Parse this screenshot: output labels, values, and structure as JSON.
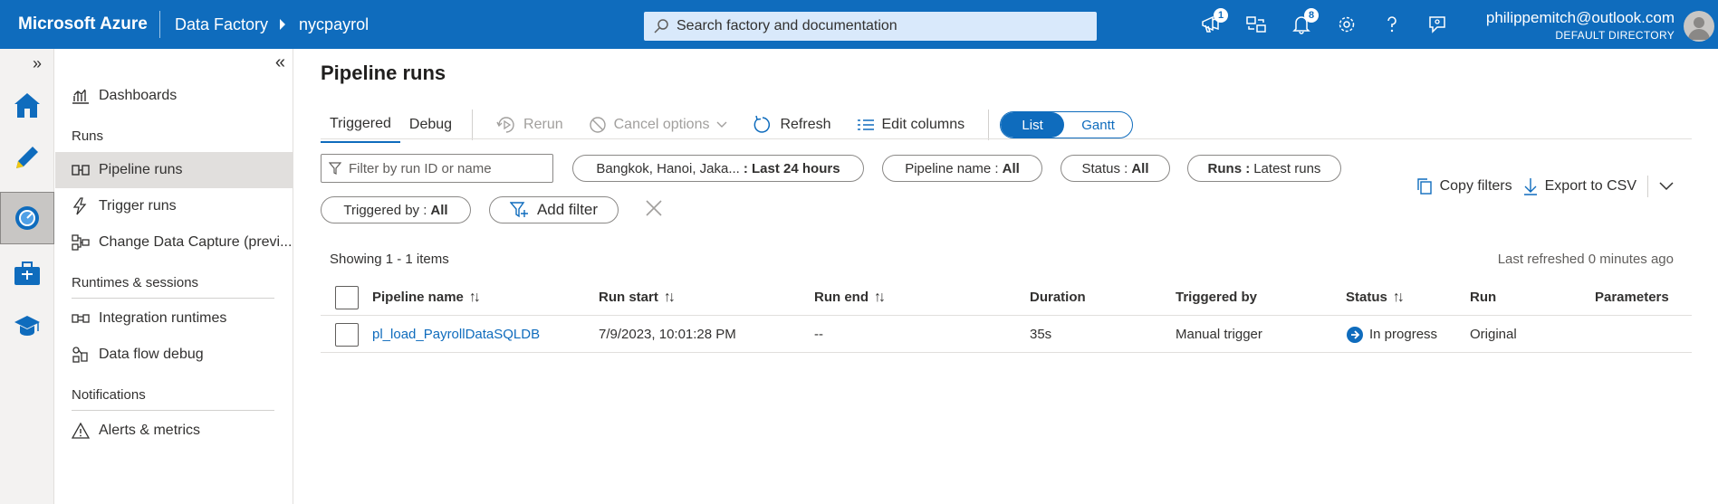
{
  "topbar": {
    "brand": "Microsoft Azure",
    "service": "Data Factory",
    "factory": "nycpayrol",
    "search_placeholder": "Search factory and documentation",
    "badges": {
      "announcements": "1",
      "notifications": "8"
    },
    "account_email": "philippemitch@outlook.com",
    "account_directory": "DEFAULT DIRECTORY",
    "accent": "#0f6cbd"
  },
  "rail": {
    "items": [
      "home-icon",
      "author-pencil-icon",
      "monitor-gauge-icon",
      "manage-toolbox-icon",
      "learning-cap-icon"
    ],
    "active": "monitor-gauge-icon"
  },
  "sidenav": {
    "dashboards": "Dashboards",
    "section_runs": "Runs",
    "pipeline_runs": "Pipeline runs",
    "trigger_runs": "Trigger runs",
    "cdc": "Change Data Capture (previ...",
    "section_runtimes": "Runtimes & sessions",
    "integration_runtimes": "Integration runtimes",
    "dataflow_debug": "Data flow debug",
    "section_notifications": "Notifications",
    "alerts": "Alerts & metrics"
  },
  "main": {
    "title": "Pipeline runs",
    "tabs": {
      "triggered": "Triggered",
      "debug": "Debug"
    },
    "toolbar": {
      "rerun": "Rerun",
      "cancel": "Cancel options",
      "refresh": "Refresh",
      "edit_columns": "Edit columns",
      "view_list": "List",
      "view_gantt": "Gantt"
    },
    "filters": {
      "search_placeholder": "Filter by run ID or name",
      "timezone": "Bangkok, Hanoi, Jaka...",
      "timerange": ": Last 24 hours",
      "pipeline_label": "Pipeline name :",
      "pipeline_value": "All",
      "status_label": "Status :",
      "status_value": "All",
      "runs_label": "Runs :",
      "runs_value": "Latest runs",
      "triggered_label": "Triggered by :",
      "triggered_value": "All",
      "add_filter": "Add filter",
      "copy_filters": "Copy filters",
      "export_csv": "Export to CSV"
    },
    "showing": "Showing 1 - 1 items",
    "last_refreshed": "Last refreshed 0 minutes ago",
    "columns": {
      "pipeline_name": "Pipeline name",
      "run_start": "Run start",
      "run_end": "Run end",
      "duration": "Duration",
      "triggered_by": "Triggered by",
      "status": "Status",
      "run": "Run",
      "parameters": "Parameters"
    },
    "rows": [
      {
        "pipeline_name": "pl_load_PayrollDataSQLDB",
        "run_start": "7/9/2023, 10:01:28 PM",
        "run_end": "--",
        "duration": "35s",
        "triggered_by": "Manual trigger",
        "status": "In progress",
        "run": "Original",
        "parameters": ""
      }
    ]
  }
}
